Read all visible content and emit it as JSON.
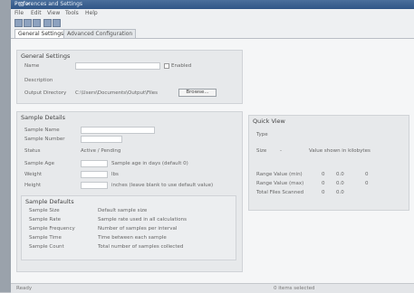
{
  "window": {
    "title": "Preferences and Settings",
    "controls": "– □ ×"
  },
  "menu": [
    "File",
    "Edit",
    "View",
    "Tools",
    "Help"
  ],
  "tabs": [
    "General Settings",
    "Advanced Configuration"
  ],
  "general": {
    "title": "General Settings",
    "fields": [
      {
        "label": "Name",
        "value": ""
      },
      {
        "label": "Description",
        "value": ""
      },
      {
        "label": "Output Directory",
        "value": "C:\\Users\\Documents\\Output\\Files"
      }
    ],
    "browse_label": "Browse...",
    "checkbox_label": "Enabled"
  },
  "sample": {
    "title": "Sample Details",
    "fields": [
      {
        "label": "Sample Name"
      },
      {
        "label": "Sample Number"
      },
      {
        "label": "Status",
        "value": "Active / Pending"
      },
      {
        "label": "Sample Age",
        "note": "Sample age in days (default 0)"
      },
      {
        "label": "Weight",
        "note": "lbs"
      },
      {
        "label": "Height",
        "note": "inches (leave blank to use default value)"
      }
    ],
    "defaults_title": "Sample Defaults",
    "defaults": [
      {
        "name": "Sample Size",
        "desc": "Default sample size"
      },
      {
        "name": "Sample Rate",
        "desc": "Sample rate used in all calculations"
      },
      {
        "name": "Sample Frequency",
        "desc": "Number of samples per interval"
      },
      {
        "name": "Sample Time",
        "desc": "Time between each sample"
      },
      {
        "name": "Sample Count",
        "desc": "Total number of samples collected"
      }
    ]
  },
  "info": {
    "title": "Quick View",
    "rows": [
      {
        "label": "Type",
        "value": ""
      },
      {
        "label": "Size",
        "value": "-",
        "note": "Value shown in kilobytes"
      }
    ],
    "stats": [
      {
        "label": "Range Value (min)",
        "a": "0",
        "b": "0.0",
        "c": "0"
      },
      {
        "label": "Range Value (max)",
        "a": "0",
        "b": "0.0",
        "c": "0"
      },
      {
        "label": "Total Files Scanned",
        "a": "0",
        "b": "0.0",
        "c": ""
      }
    ]
  },
  "status": {
    "left": "Ready",
    "right": "0 items selected"
  },
  "colors": {
    "title_bar": "#2f5586",
    "panel": "#e7e9eb"
  }
}
